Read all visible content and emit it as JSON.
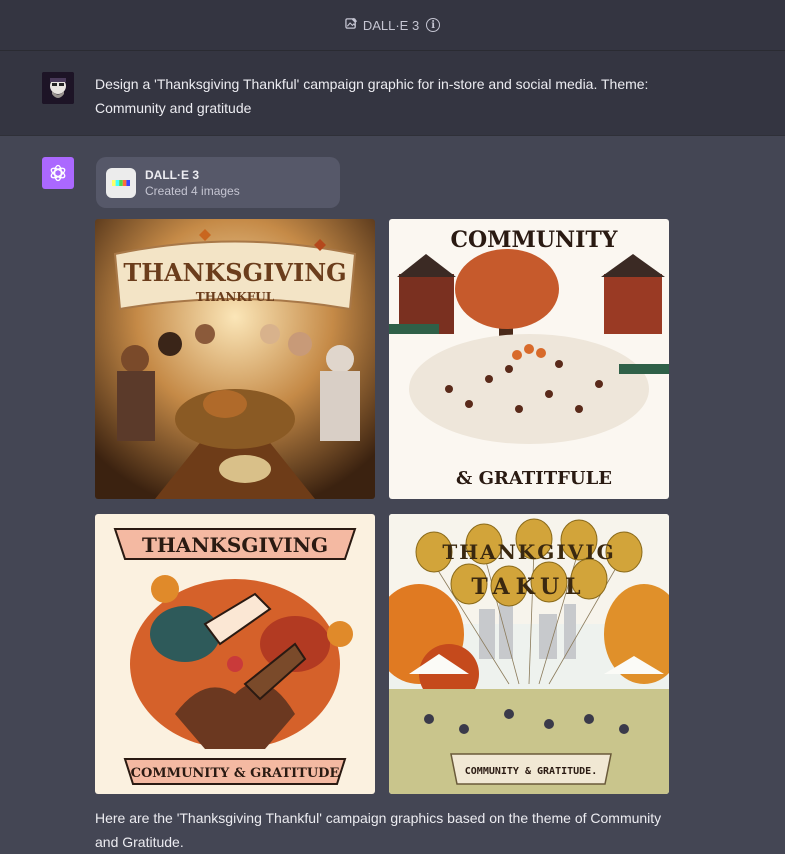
{
  "header": {
    "model_name": "DALL·E 3",
    "info_glyph": "i"
  },
  "user_message": {
    "text": "Design a 'Thanksgiving Thankful' campaign graphic for in-store and social media. Theme: Community and gratitude"
  },
  "dalle_card": {
    "title": "DALL·E 3",
    "subtitle": "Created 4 images"
  },
  "images": [
    {
      "banner": "THANKSGIVING",
      "sub": "THANKFUL"
    },
    {
      "banner": "COMMUNITY",
      "sub": "& GRATITFULE"
    },
    {
      "banner": "THANKSGIVING",
      "sub": "COMMUNITY & GRATITUDE"
    },
    {
      "balloons_top": "THANKGIVIG",
      "balloons_bottom": "TAKUL",
      "sub": "COMMUNITY & GRATITUDE."
    }
  ],
  "response": {
    "text": "Here are the 'Thanksgiving Thankful' campaign graphics based on the theme of Community and Gratitude."
  },
  "colors": {
    "background": "#444654",
    "topbar": "#343541",
    "ai_avatar": "#ab68ff",
    "card": "#565869"
  }
}
